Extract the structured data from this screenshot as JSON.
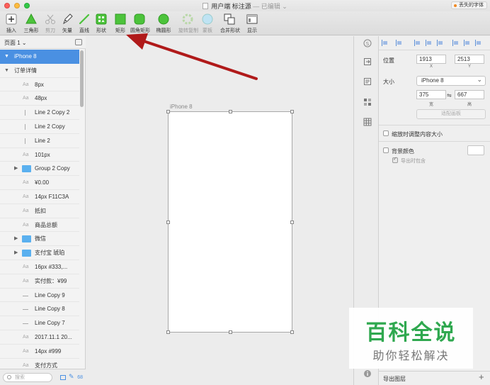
{
  "window": {
    "title": "用户端 标注源",
    "title_suffix": "— 已编辑",
    "missing_fonts": "丢失的字体"
  },
  "toolbar": [
    {
      "label": "插入",
      "icon": "plus-icon",
      "disabled": false
    },
    {
      "label": "三角形",
      "icon": "triangle-icon",
      "disabled": false
    },
    {
      "label": "剪刀",
      "icon": "scissors-icon",
      "disabled": true
    },
    {
      "label": "矢量",
      "icon": "vector-pen-icon",
      "disabled": false
    },
    {
      "label": "直线",
      "icon": "line-icon",
      "disabled": false
    },
    {
      "label": "形状",
      "icon": "shapes-icon",
      "disabled": false
    },
    {
      "label": "矩形",
      "icon": "rectangle-icon",
      "disabled": false
    },
    {
      "label": "圆角矩形",
      "icon": "rounded-rectangle-icon",
      "disabled": false
    },
    {
      "label": "椭圆形",
      "icon": "ellipse-icon",
      "disabled": false
    },
    {
      "label": "旋转复制",
      "icon": "rotate-copy-icon",
      "disabled": true
    },
    {
      "label": "蒙板",
      "icon": "mask-icon",
      "disabled": true
    },
    {
      "label": "合并形状",
      "icon": "combine-shapes-icon",
      "disabled": false
    },
    {
      "label": "显示",
      "icon": "view-icon",
      "disabled": false
    }
  ],
  "pages": {
    "current": "页面 1"
  },
  "layers": [
    {
      "name": "iPhone 8",
      "kind": "artboard",
      "selected": true
    },
    {
      "name": "订单详情",
      "kind": "group-open",
      "selected": false
    },
    {
      "name": "8px",
      "kind": "text"
    },
    {
      "name": "48px",
      "kind": "text"
    },
    {
      "name": "Line 2 Copy 2",
      "kind": "line"
    },
    {
      "name": "Line 2 Copy",
      "kind": "line"
    },
    {
      "name": "Line 2",
      "kind": "line"
    },
    {
      "name": "101px",
      "kind": "text"
    },
    {
      "name": "Group 2 Copy",
      "kind": "folder"
    },
    {
      "name": "¥0.00",
      "kind": "text"
    },
    {
      "name": "14px F11C3A",
      "kind": "text"
    },
    {
      "name": "抵扣",
      "kind": "text"
    },
    {
      "name": "商品总额",
      "kind": "text"
    },
    {
      "name": "微信",
      "kind": "folder"
    },
    {
      "name": "支付宝 琥珀",
      "kind": "folder"
    },
    {
      "name": "16px #333,...",
      "kind": "text"
    },
    {
      "name": "实付款：¥99",
      "kind": "text"
    },
    {
      "name": "Line Copy 9",
      "kind": "hline"
    },
    {
      "name": "Line Copy 8",
      "kind": "hline"
    },
    {
      "name": "Line Copy 7",
      "kind": "hline"
    },
    {
      "name": "2017.11.1 20...",
      "kind": "text"
    },
    {
      "name": "14px #999",
      "kind": "text"
    },
    {
      "name": "支付方式",
      "kind": "text"
    }
  ],
  "layer_footer": {
    "search_placeholder": "搜索",
    "count": "68"
  },
  "canvas": {
    "artboard_name": "iPhone 8"
  },
  "inspector": {
    "position_label": "位置",
    "x_value": "1913",
    "y_value": "2513",
    "x_label": "X",
    "y_label": "Y",
    "size_label": "大小",
    "size_preset": "iPhone 8",
    "width_value": "375",
    "height_value": "667",
    "width_label": "宽",
    "height_label": "高",
    "fit_button": "适配画板",
    "resize_content": "缩放时调整内容大小",
    "background_color": "背景颜色",
    "include_on_export": "导出时包含",
    "export_layer": "导出图层"
  },
  "watermark": {
    "title": "百科全说",
    "subtitle": "助你轻松解决"
  },
  "colors": {
    "selection": "#4a90e2",
    "annotation_arrow": "#b01a1a",
    "shape_green": "#4cc33b",
    "watermark_green": "#2fa84f"
  }
}
